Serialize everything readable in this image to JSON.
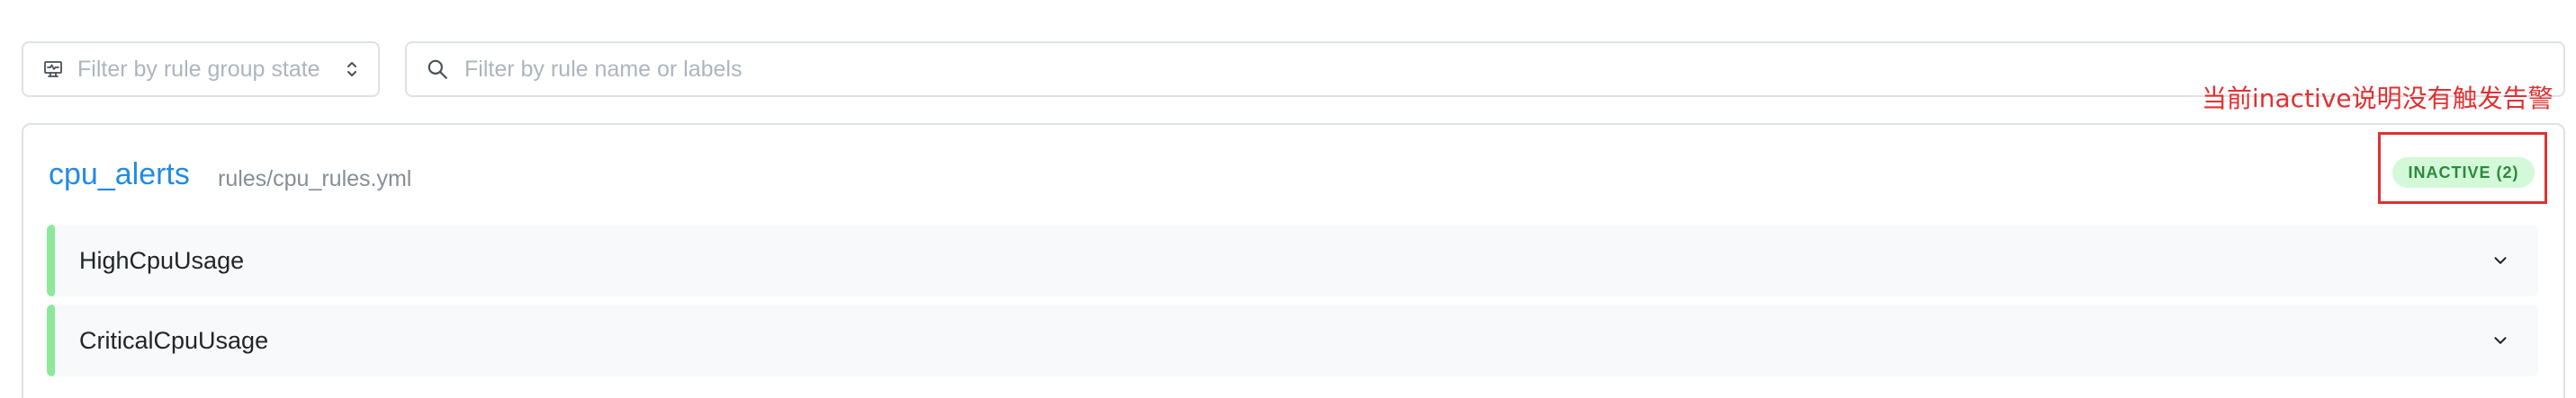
{
  "filters": {
    "state_placeholder": "Filter by rule group state",
    "state_icon": "heart-rate-monitor-icon",
    "search_placeholder": "Filter by rule name or labels",
    "search_icon": "search-icon"
  },
  "group": {
    "name": "cpu_alerts",
    "file": "rules/cpu_rules.yml",
    "badge": "INACTIVE (2)",
    "annotation": "当前inactive说明没有触发告警",
    "rules": [
      {
        "name": "HighCpuUsage"
      },
      {
        "name": "CriticalCpuUsage"
      }
    ]
  },
  "colors": {
    "title": "#228be6",
    "badge_bg": "#d3f9d8",
    "badge_text": "#2b8a3e",
    "rule_accent": "#8ce99a",
    "annotation": "#e03131"
  }
}
